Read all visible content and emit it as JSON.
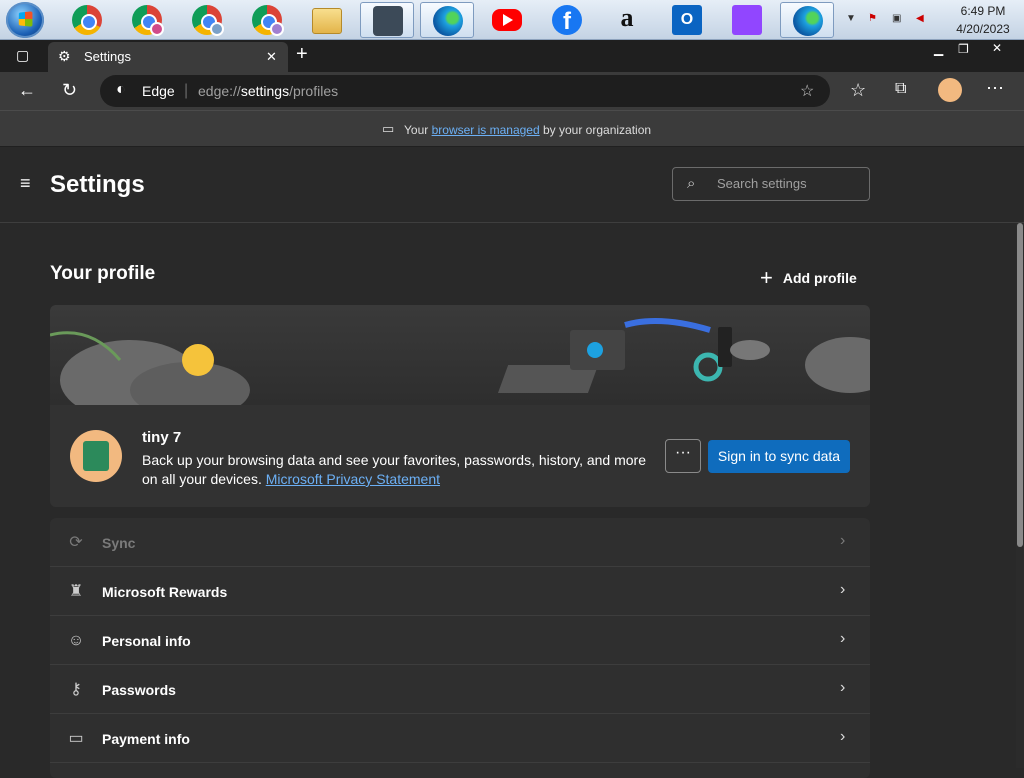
{
  "taskbar": {
    "clock_time": "6:49 PM",
    "clock_date": "4/20/2023"
  },
  "tab": {
    "label": "Settings"
  },
  "addressbar": {
    "site": "Edge",
    "url_prefix": "edge://",
    "url_host": "settings",
    "url_path": "/profiles"
  },
  "infobar": {
    "prefix": "Your ",
    "link": "browser is managed",
    "suffix": " by your organization"
  },
  "header": {
    "title": "Settings",
    "search_placeholder": "Search settings"
  },
  "profile": {
    "section_title": "Your profile",
    "add_profile": "Add profile",
    "name": "tiny 7",
    "description": "Back up your browsing data and see your favorites, passwords, history, and more on all your devices. ",
    "privacy_link": "Microsoft Privacy Statement",
    "more_label": "···",
    "signin_label": "Sign in to sync data"
  },
  "settings_list": {
    "items": [
      {
        "label": "Sync"
      },
      {
        "label": "Microsoft Rewards"
      },
      {
        "label": "Personal info"
      },
      {
        "label": "Passwords"
      },
      {
        "label": "Payment info"
      }
    ]
  },
  "colors": {
    "accent": "#0f6cbd",
    "link": "#6cb0f5",
    "background": "#292929"
  }
}
